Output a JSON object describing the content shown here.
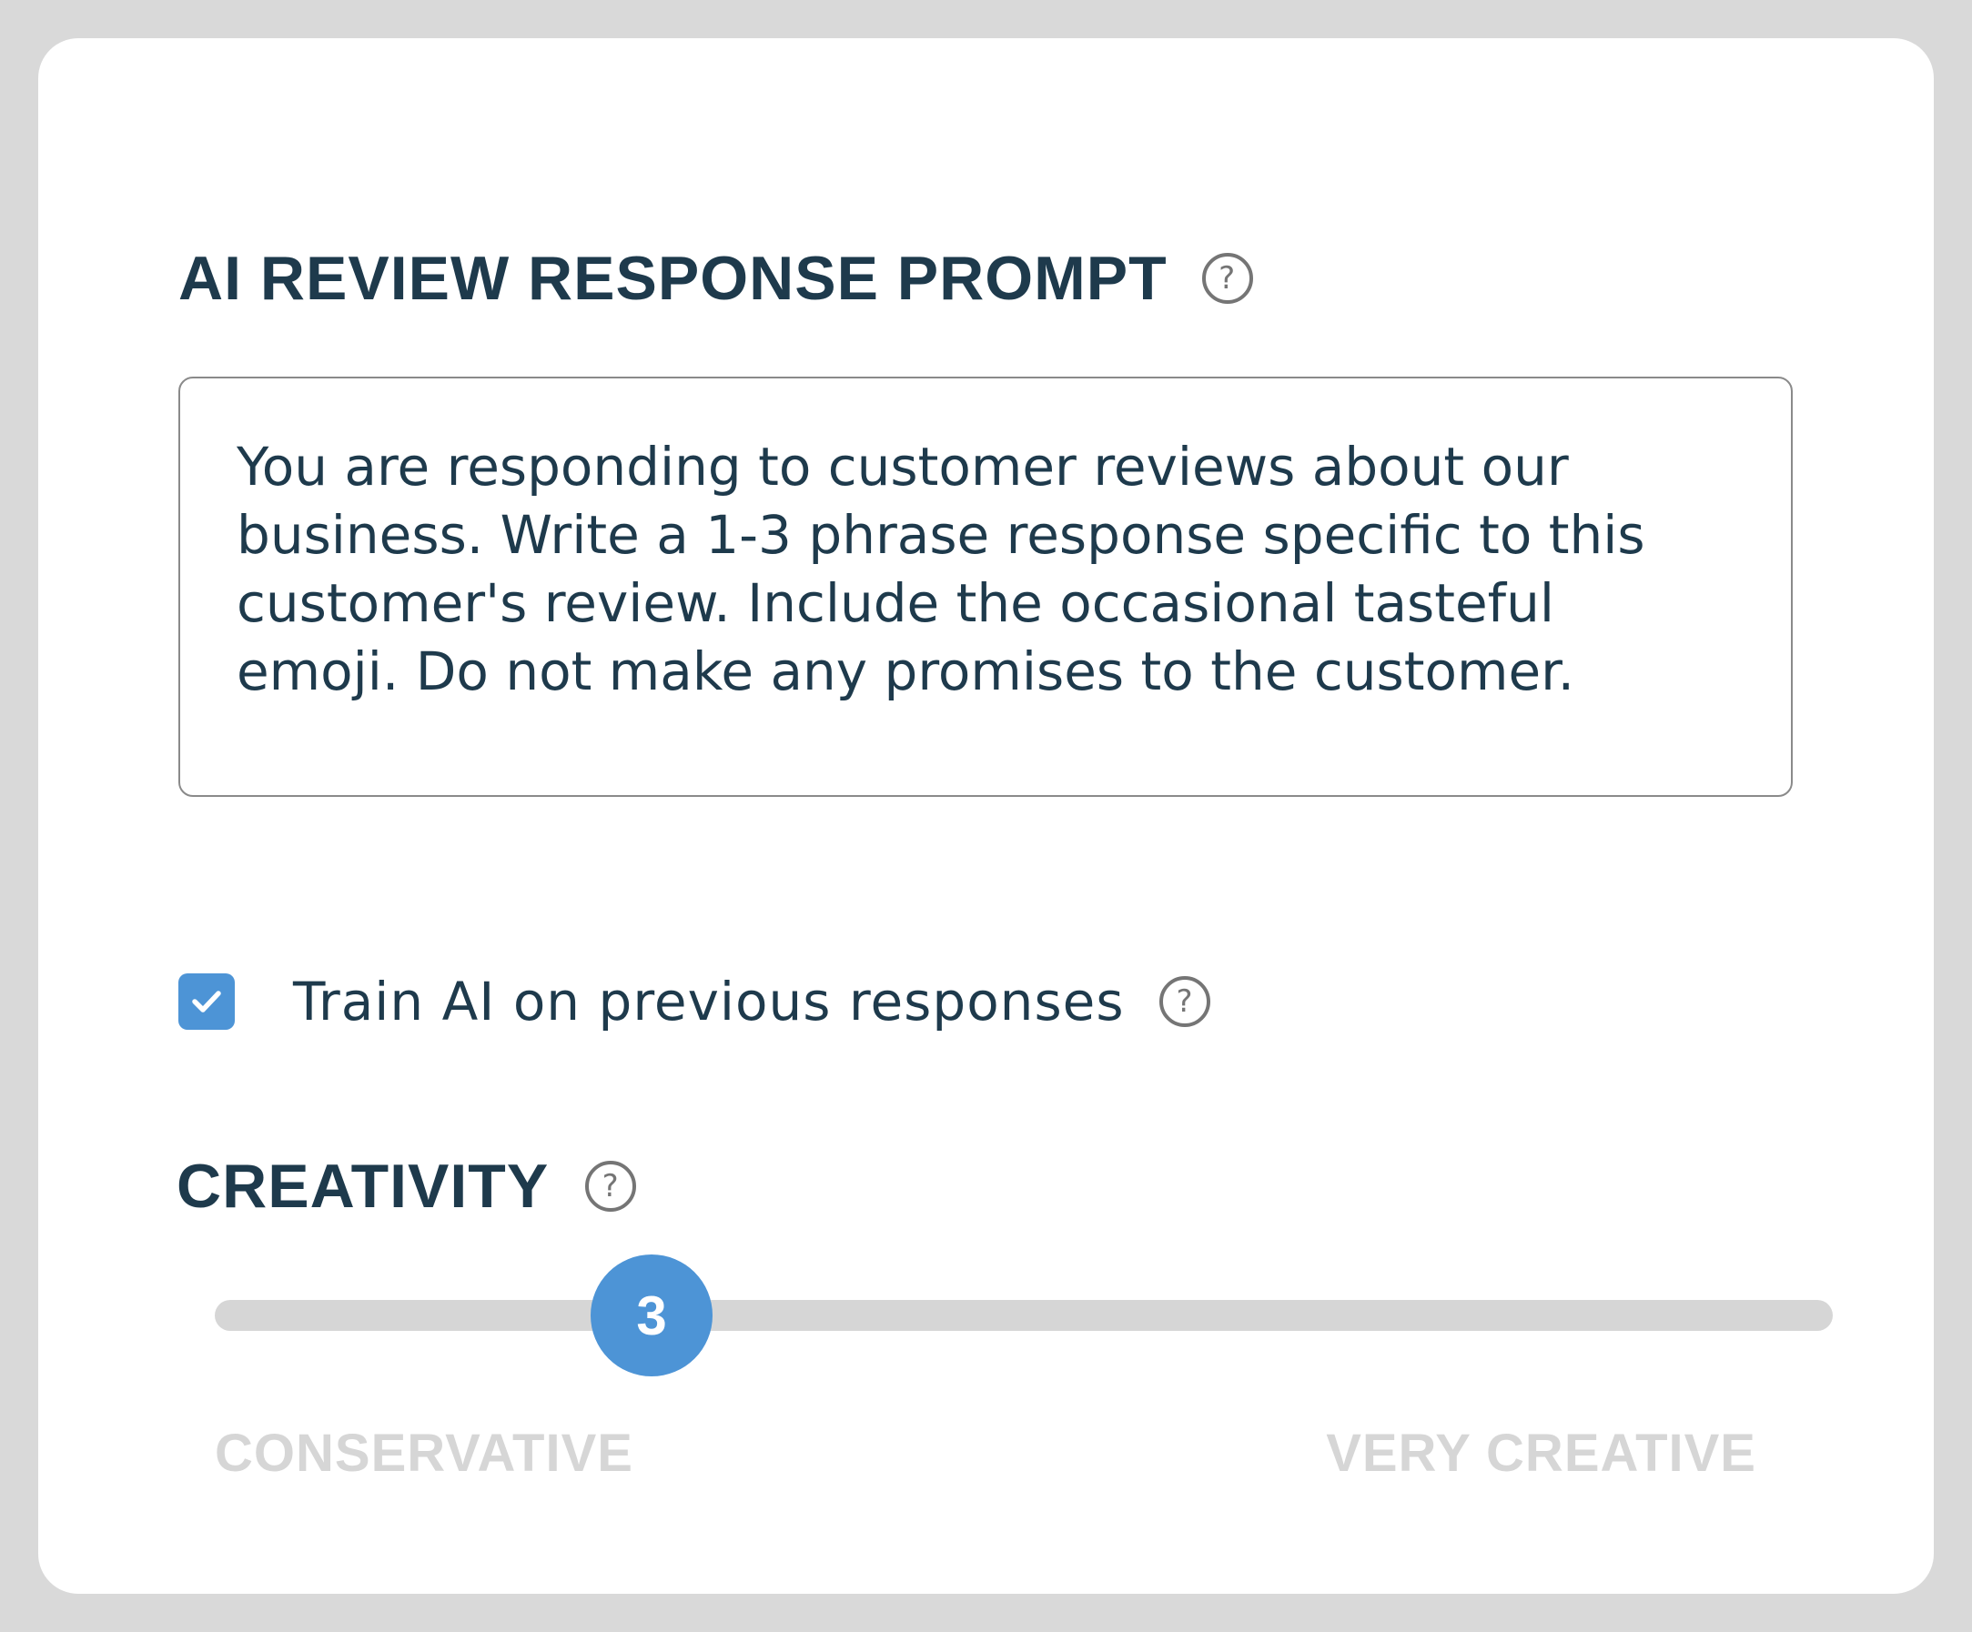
{
  "prompt_section": {
    "title": "AI REVIEW RESPONSE PROMPT",
    "help_icon": "question-circle-icon",
    "prompt_text": "You are responding to customer reviews about our\nbusiness. Write a 1-3 phrase response specific to this\ncustomer's review. Include the occasional tasteful\nemoji. Do not make any promises to the customer."
  },
  "training": {
    "label": "Train AI on previous responses",
    "checked": true,
    "help_icon": "question-circle-icon"
  },
  "creativity": {
    "title": "CREATIVITY",
    "help_icon": "question-circle-icon",
    "value": "3",
    "value_fraction": 0.27,
    "min_label": "CONSERVATIVE",
    "max_label": "VERY CREATIVE"
  },
  "colors": {
    "accent": "#4d94d6",
    "heading": "#1e3a4c",
    "track": "#d6d6d6",
    "frame": "#d9d9d9"
  }
}
